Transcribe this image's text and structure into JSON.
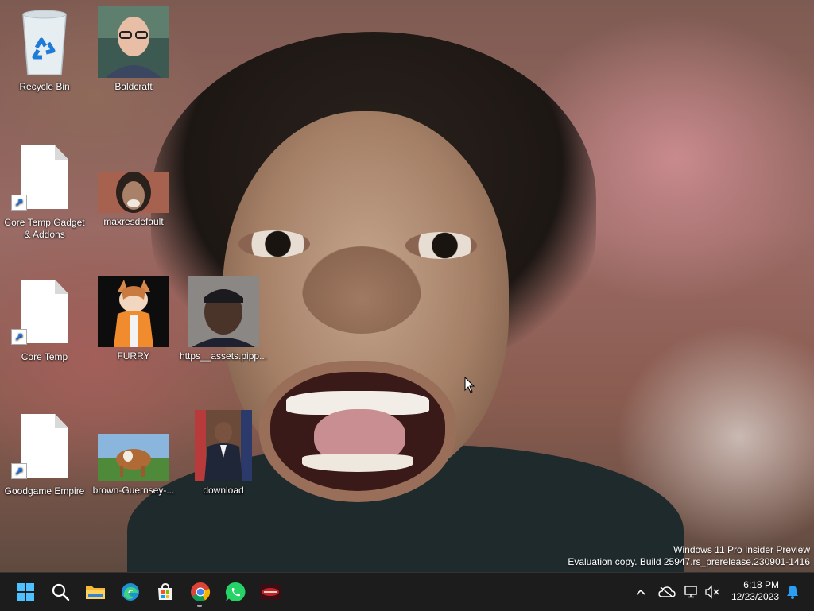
{
  "desktop": {
    "icons": [
      {
        "label": "Recycle Bin"
      },
      {
        "label": "Baldcraft"
      },
      {
        "label": "Core Temp Gadget & Addons"
      },
      {
        "label": "maxresdefault"
      },
      {
        "label": "Core Temp"
      },
      {
        "label": "FURRY"
      },
      {
        "label": "https__assets.pipp..."
      },
      {
        "label": "Goodgame Empire"
      },
      {
        "label": "brown-Guernsey-..."
      },
      {
        "label": "download"
      }
    ]
  },
  "watermark": {
    "line1": "Windows 11 Pro Insider Preview",
    "line2": "Evaluation copy. Build 25947.rs_prerelease.230901-1416"
  },
  "taskbar": {
    "apps": [
      {
        "icon": "start-icon"
      },
      {
        "icon": "search-icon"
      },
      {
        "icon": "file-explorer-icon"
      },
      {
        "icon": "edge-icon"
      },
      {
        "icon": "microsoft-store-icon"
      },
      {
        "icon": "chrome-icon"
      },
      {
        "icon": "whatsapp-icon"
      },
      {
        "icon": "game-app-icon"
      }
    ],
    "tray": {
      "icons": [
        "chevron-up-icon",
        "onedrive-icon",
        "network-icon",
        "volume-muted-icon",
        "notification-bell-icon"
      ]
    },
    "clock": {
      "time": "6:18 PM",
      "date": "12/23/2023"
    }
  },
  "colors": {
    "taskbar_bg": "#1c1c1c",
    "accent": "#0a84ff"
  }
}
